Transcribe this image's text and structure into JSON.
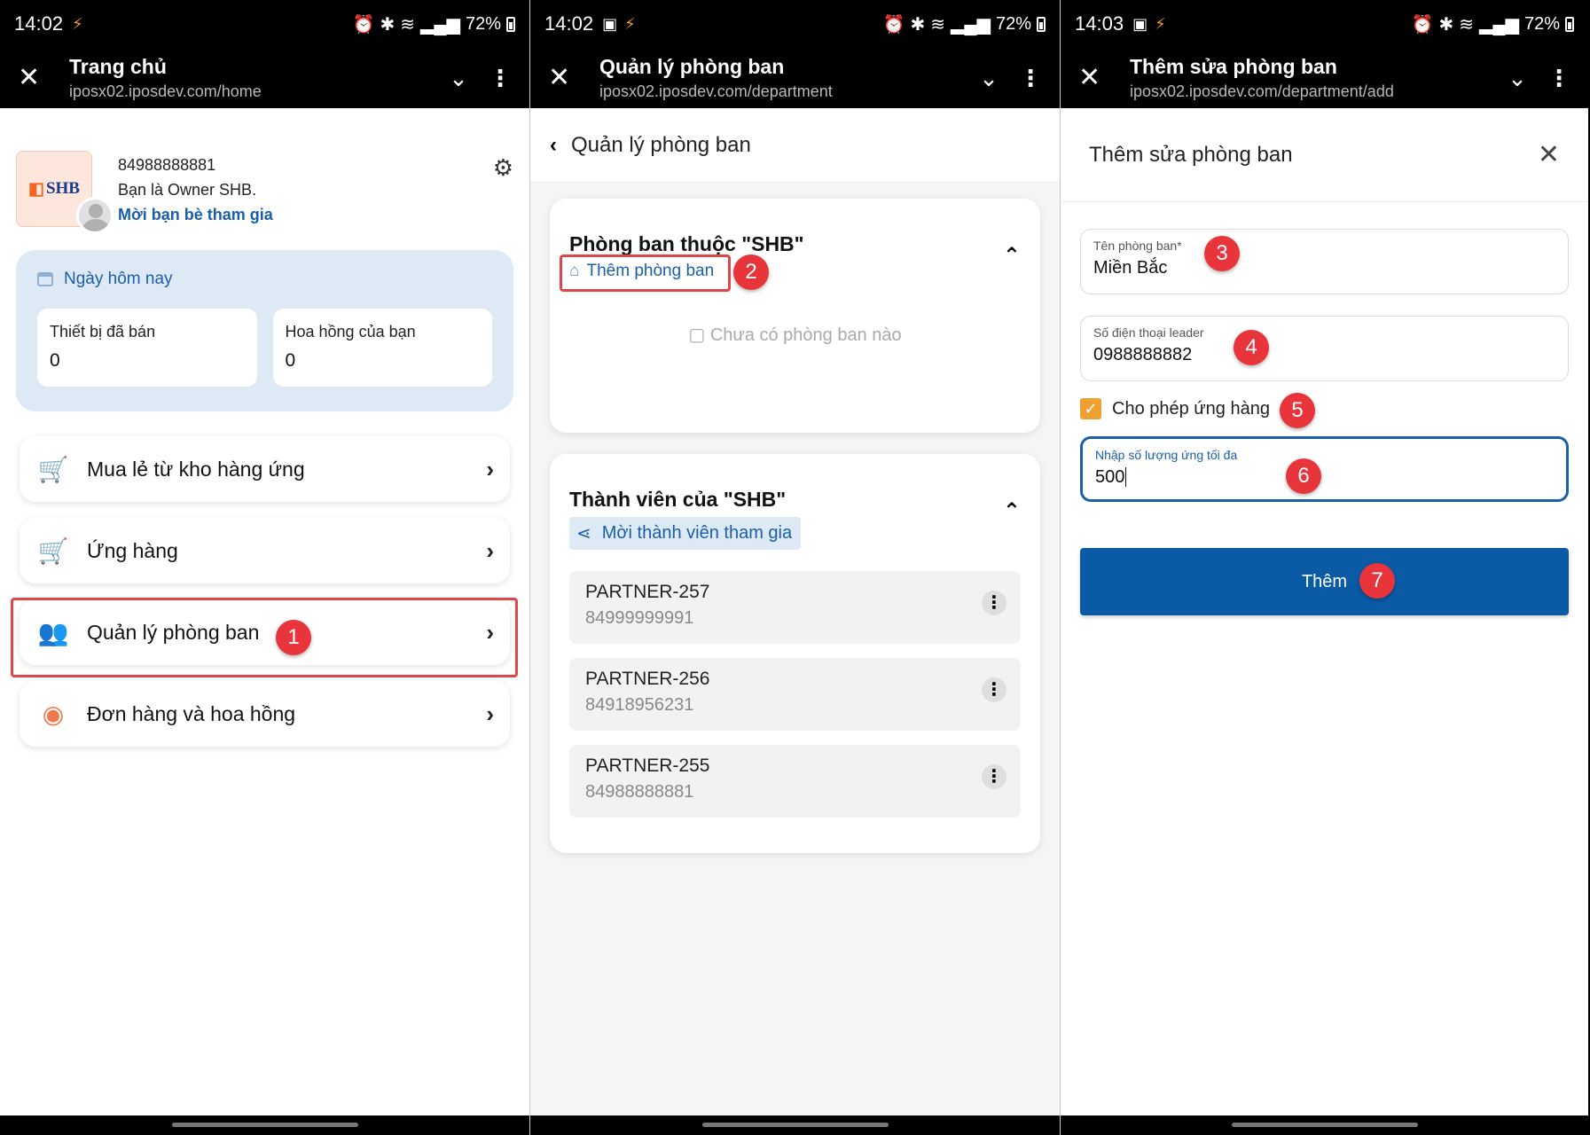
{
  "status_bars": [
    {
      "time": "14:02",
      "battery": "72%"
    },
    {
      "time": "14:02",
      "battery": "72%"
    },
    {
      "time": "14:03",
      "battery": "72%"
    }
  ],
  "screen1": {
    "browser": {
      "title": "Trang chủ",
      "url": "iposx02.iposdev.com/home"
    },
    "profile": {
      "logo_text": "SHB",
      "phone": "84988888881",
      "role": "Bạn là Owner SHB.",
      "invite": "Mời bạn bè tham gia"
    },
    "today": {
      "title": "Ngày hôm nay",
      "cards": [
        {
          "label": "Thiết bị đã bán",
          "value": "0"
        },
        {
          "label": "Hoa hồng của bạn",
          "value": "0"
        }
      ]
    },
    "menu": [
      {
        "label": "Mua lẻ từ kho hàng ứng",
        "icon": "cart-icon"
      },
      {
        "label": "Ứng hàng",
        "icon": "cart-green-icon"
      },
      {
        "label": "Quản lý phòng ban",
        "icon": "team-icon"
      },
      {
        "label": "Đơn hàng và hoa hồng",
        "icon": "orders-icon"
      }
    ],
    "step": "1"
  },
  "screen2": {
    "browser": {
      "title": "Quản lý phòng ban",
      "url": "iposx02.iposdev.com/department"
    },
    "header": "Quản lý phòng ban",
    "departments": {
      "title": "Phòng ban thuộc \"SHB\"",
      "add_link": "Thêm phòng ban",
      "empty": "Chưa có phòng ban nào"
    },
    "members": {
      "title": "Thành viên của \"SHB\"",
      "invite": "Mời thành viên tham gia",
      "items": [
        {
          "name": "PARTNER-257",
          "phone": "84999999991"
        },
        {
          "name": "PARTNER-256",
          "phone": "84918956231"
        },
        {
          "name": "PARTNER-255",
          "phone": "84988888881"
        }
      ]
    },
    "step": "2"
  },
  "screen3": {
    "browser": {
      "title": "Thêm sửa phòng ban",
      "url": "iposx02.iposdev.com/department/add"
    },
    "header": "Thêm sửa phòng ban",
    "fields": {
      "name": {
        "label": "Tên phòng ban*",
        "value": "Miền Bắc"
      },
      "phone": {
        "label": "Số điện thoại leader",
        "value": "0988888882"
      },
      "allow": {
        "label": "Cho phép ứng hàng"
      },
      "max": {
        "label": "Nhập số lượng ứng tối đa",
        "value": "500"
      }
    },
    "submit": "Thêm",
    "steps": [
      "3",
      "4",
      "5",
      "6",
      "7"
    ]
  },
  "colors": {
    "accent": "#1a5fa8",
    "highlight": "#e0474d",
    "badge": "#e8343b",
    "button": "#0a5aa6",
    "checkbox": "#f0a030"
  }
}
